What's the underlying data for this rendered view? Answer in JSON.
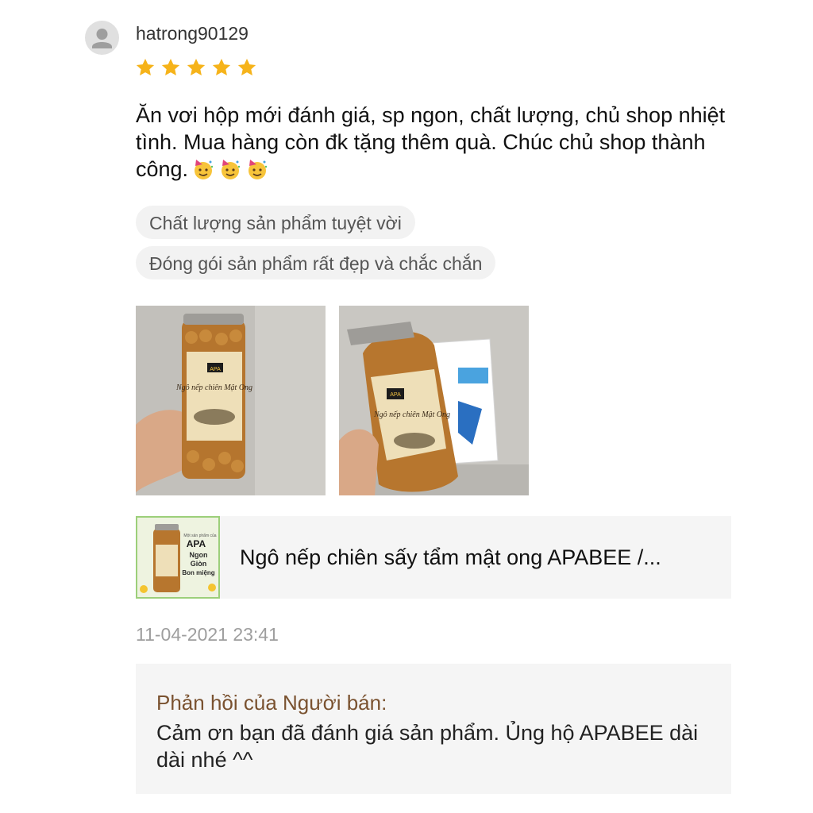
{
  "review": {
    "username": "hatrong90129",
    "rating": 5,
    "max_rating": 5,
    "text": "Ăn vơi hộp mới đánh giá, sp ngon, chất lượng, chủ shop nhiệt tình. Mua hàng còn đk tặng thêm quà. Chúc chủ shop thành công.",
    "emoji_count": 3,
    "tags": [
      "Chất lượng sản phẩm tuyệt vời",
      "Đóng gói sản phẩm rất đẹp và chắc chắn"
    ],
    "timestamp": "11-04-2021 23:41"
  },
  "photos": [
    {
      "icon": "product-photo-jar-in-hand",
      "label": "APA",
      "title": "Ngô nếp chiên Mật Ong"
    },
    {
      "icon": "product-photo-jar-with-gift",
      "label": "APA",
      "title": "Ngô nếp chiên Mật Ong"
    }
  ],
  "product": {
    "name": "Ngô nếp chiên sấy tẩm mật ong APABEE /...",
    "thumb_text": {
      "small": "Một sản phẩm của",
      "brand": "APA",
      "line1": "Ngon",
      "line2": "Giòn",
      "line3": "Bon miệng"
    }
  },
  "seller_reply": {
    "title": "Phản hồi của Người bán:",
    "text": "Cảm ơn bạn đã đánh giá sản phẩm. Ủng hộ APABEE dài dài nhé ^^"
  },
  "colors": {
    "star": "#f6b31a",
    "reply_title": "#7a5230",
    "tag_bg": "#f2f2f2",
    "panel_bg": "#f5f5f5"
  }
}
